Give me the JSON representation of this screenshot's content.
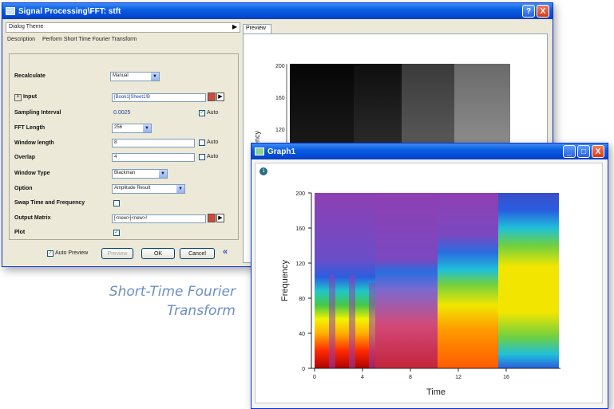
{
  "dialog": {
    "title": "Signal Processing\\FFT: stft",
    "help_glyph": "?",
    "close_glyph": "X",
    "theme_label": "Dialog Theme",
    "theme_arrow": "▶",
    "preview_tab": "Preview",
    "description_label": "Description",
    "description_text": "Perform Short Time Fourier Transform",
    "rows": {
      "recalculate": {
        "label": "Recalculate",
        "value": "Manual"
      },
      "input": {
        "label": "Input",
        "value": "[Book1]Sheet1!B"
      },
      "sampling": {
        "label": "Sampling Interval",
        "value": "0.0025",
        "auto_label": "Auto"
      },
      "fft_length": {
        "label": "FFT Length",
        "value": "256"
      },
      "window_length": {
        "label": "Window length",
        "value": "8",
        "auto_label": "Auto"
      },
      "overlap": {
        "label": "Overlap",
        "value": "4",
        "auto_label": "Auto"
      },
      "window_type": {
        "label": "Window Type",
        "value": "Blackman"
      },
      "option": {
        "label": "Option",
        "value": "Amplitude Result"
      },
      "swap": {
        "label": "Swap Time and Frequency"
      },
      "output_matrix": {
        "label": "Output Matrix",
        "value": "[<new>]<new>!"
      },
      "plot": {
        "label": "Plot"
      }
    },
    "auto_preview_label": "Auto Preview",
    "preview_button": "Preview",
    "ok_button": "OK",
    "cancel_button": "Cancel",
    "collapse_glyph": "«",
    "preview_ticks": [
      "200",
      "160",
      "120"
    ],
    "preview_ylabel_partial": "ency"
  },
  "graph": {
    "title": "Graph1",
    "layer_indicator": "1",
    "ylabel": "Frequency",
    "xlabel": "Time",
    "yticks": [
      "200",
      "160",
      "120",
      "80",
      "40",
      "0"
    ],
    "xticks": [
      "0",
      "4",
      "8",
      "12",
      "16"
    ]
  },
  "caption": {
    "line1": "Short-Time Fourier",
    "line2": "Transform"
  },
  "colors": {
    "titlebar_blue": "#0a5ee0",
    "dialog_bg": "#ece9d8",
    "caption_blue": "#6c8fc4"
  }
}
